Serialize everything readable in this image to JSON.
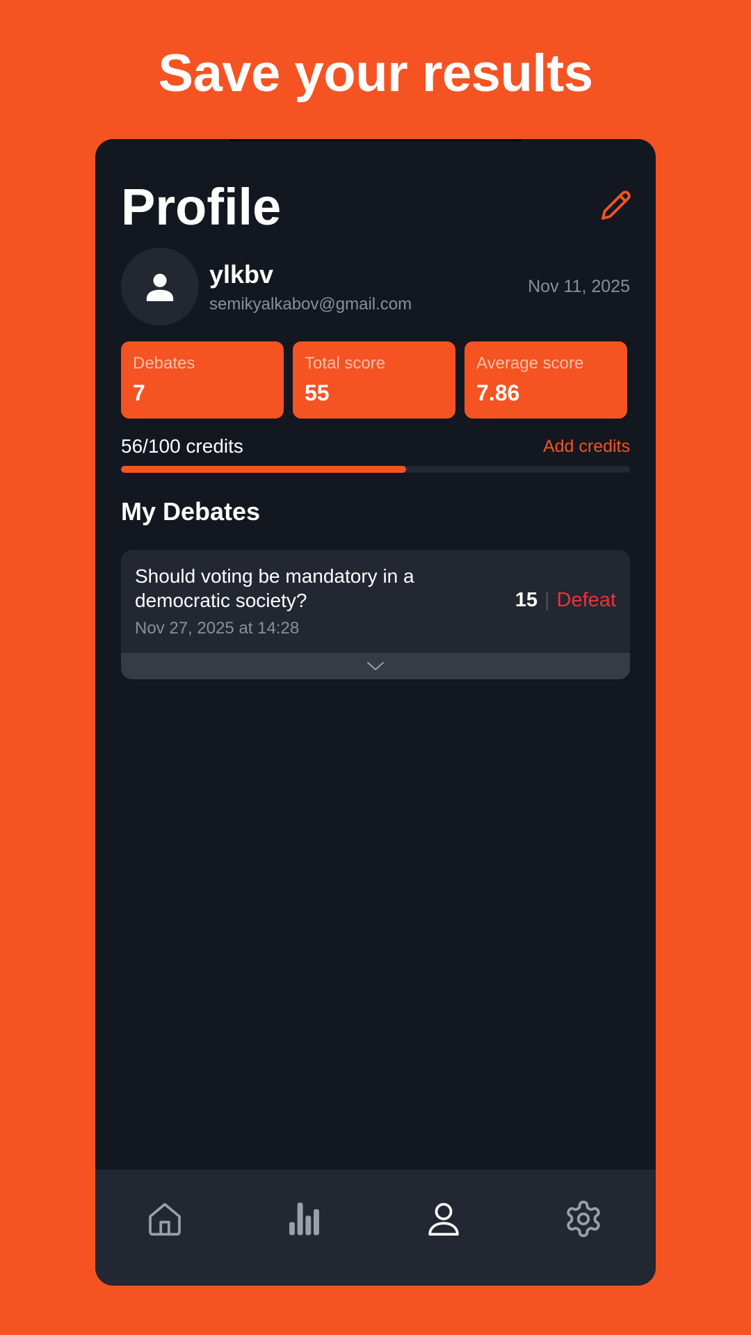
{
  "headline": "Save your results",
  "profile": {
    "title": "Profile",
    "username": "ylkbv",
    "email": "semikyalkabov@gmail.com",
    "joined": "Nov 11, 2025"
  },
  "stats": [
    {
      "label": "Debates",
      "value": "7"
    },
    {
      "label": "Total score",
      "value": "55"
    },
    {
      "label": "Average score",
      "value": "7.86"
    }
  ],
  "credits": {
    "text": "56/100 credits",
    "used": 56,
    "total": 100,
    "add_label": "Add credits"
  },
  "debates_section": {
    "title": "My Debates",
    "items": [
      {
        "question": "Should voting be mandatory in a democratic society?",
        "date": "Nov 27, 2025 at 14:28",
        "score": "15",
        "separator": "|",
        "outcome": "Defeat"
      }
    ]
  },
  "tabbar": {
    "tabs": [
      {
        "icon": "home-icon"
      },
      {
        "icon": "bar-chart-icon"
      },
      {
        "icon": "person-icon",
        "active": true
      },
      {
        "icon": "gear-icon"
      }
    ]
  },
  "colors": {
    "accent": "#F55322",
    "background": "#121720",
    "card": "#222731",
    "defeat": "#e8333e"
  }
}
